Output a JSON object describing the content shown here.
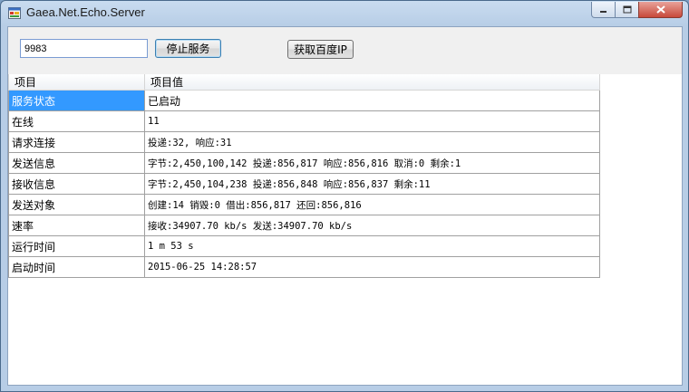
{
  "window": {
    "title": "Gaea.Net.Echo.Server"
  },
  "toolbar": {
    "port_value": "9983",
    "stop_label": "停止服务",
    "baidu_ip_label": "获取百度IP"
  },
  "grid": {
    "headers": [
      "项目",
      "项目值"
    ],
    "rows": [
      {
        "item": "服务状态",
        "value": "已启动"
      },
      {
        "item": "在线",
        "value": "11"
      },
      {
        "item": "请求连接",
        "value": "投递:32, 响应:31"
      },
      {
        "item": "发送信息",
        "value": "字节:2,450,100,142  投递:856,817  响应:856,816  取消:0  剩余:1"
      },
      {
        "item": "接收信息",
        "value": "字节:2,450,104,238  投递:856,848  响应:856,837  剩余:11"
      },
      {
        "item": "发送对象",
        "value": "创建:14  销毁:0  借出:856,817  还回:856,816"
      },
      {
        "item": "速率",
        "value": "接收:34907.70 kb/s 发送:34907.70 kb/s"
      },
      {
        "item": "运行时间",
        "value": "1 m 53 s"
      },
      {
        "item": "启动时间",
        "value": "2015-06-25 14:28:57"
      }
    ]
  },
  "icons": {
    "app": "app-window-icon",
    "minimize": "minimize-icon",
    "maximize": "maximize-icon",
    "close": "close-icon"
  },
  "colors": {
    "selection": "#3399ff"
  }
}
